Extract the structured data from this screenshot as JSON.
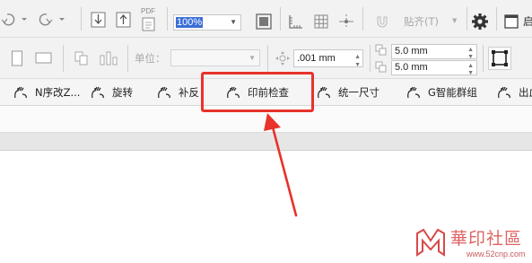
{
  "toolbar": {
    "pdf_label": "PDF",
    "zoom_value": "100%",
    "snap_label": "贴齐(T)",
    "window_label_partial": "启"
  },
  "propertybar": {
    "unit_label": "单位：",
    "nudge_value": ".001 mm",
    "dup_x": "5.0 mm",
    "dup_y": "5.0 mm"
  },
  "plugins": [
    {
      "label": "N序改Z..."
    },
    {
      "label": "旋转"
    },
    {
      "label": "补反"
    },
    {
      "label": "印前检查"
    },
    {
      "label": "统一尺寸"
    },
    {
      "label": "G智能群组"
    },
    {
      "label": "出血"
    }
  ],
  "highlight": {
    "target": "印前检查",
    "color": "#e8322b"
  },
  "watermark": {
    "title": "華印社區",
    "url": "www.52cnp.com"
  },
  "colors": {
    "accent": "#e8322b",
    "zoom_selection": "#3b6fd6",
    "watermark": "#d94848"
  }
}
